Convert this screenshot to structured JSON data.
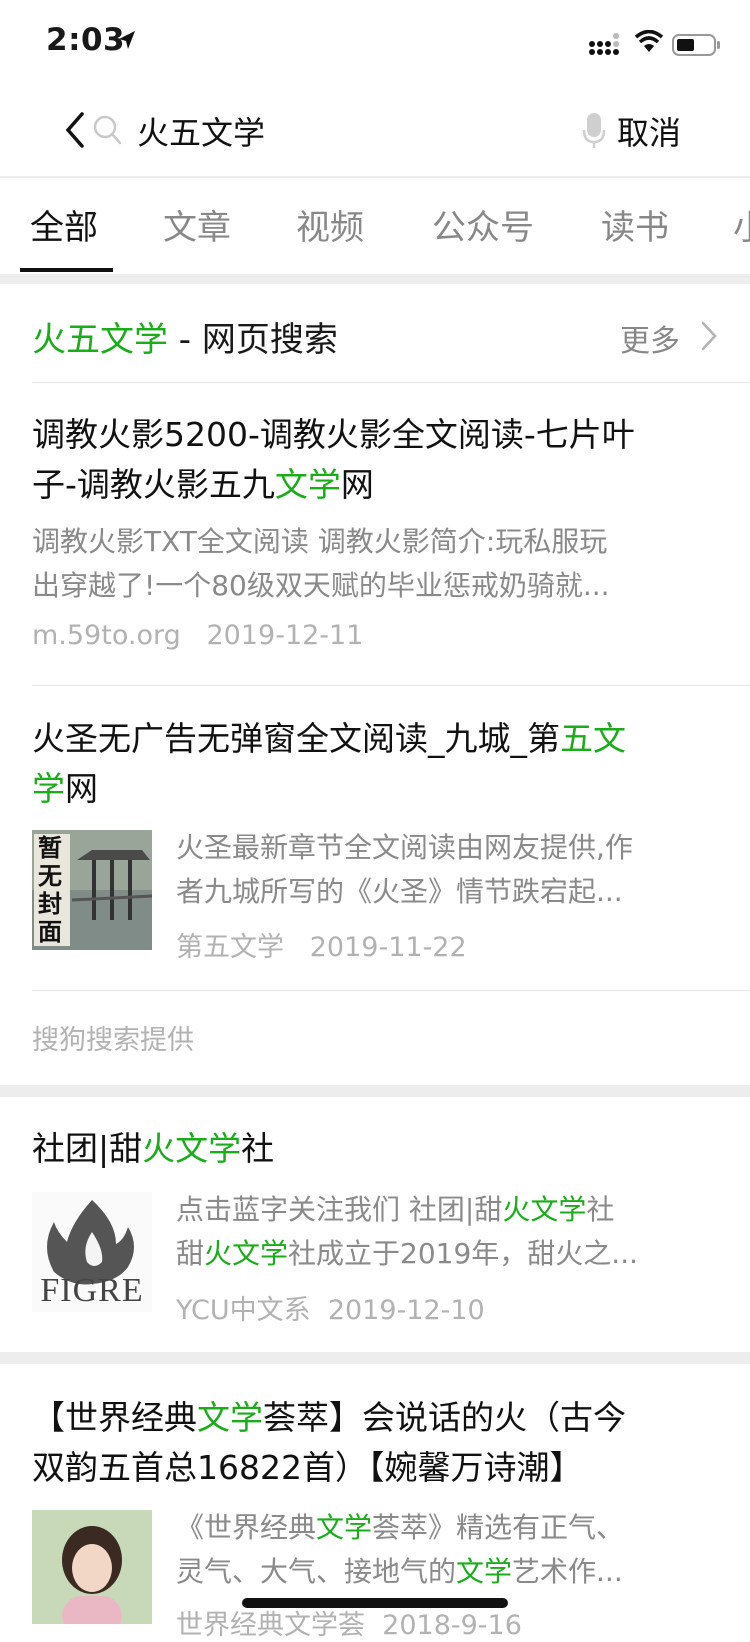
{
  "status": {
    "time": "2:03"
  },
  "search": {
    "query": "火五文学",
    "cancel": "取消"
  },
  "tabs": [
    "全部",
    "文章",
    "视频",
    "公众号",
    "读书",
    "小"
  ],
  "web_section": {
    "title_hl": "火五文学",
    "title_rest": " - 网页搜索",
    "more": "更多",
    "provider": "搜狗搜索提供"
  },
  "results": [
    {
      "title_line1": "调教火影5200-调教火影全文阅读-七片叶",
      "title_line2_pre": "子-调教火影五九",
      "title_line2_hl": "文学",
      "title_line2_post": "网",
      "desc_line1": "调教火影TXT全文阅读 调教火影简介:玩私服玩",
      "desc_line2": "出穿越了!一个80级双天赋的毕业惩戒奶骑就...",
      "source": "m.59to.org",
      "date": "2019-12-11"
    },
    {
      "title_line1_pre": "火圣无广告无弹窗全文阅读_九城_第",
      "title_line1_hl": "五文",
      "title_line2_hl": "学",
      "title_line2_post": "网",
      "desc_line1": "火圣最新章节全文阅读由网友提供,作",
      "desc_line2": "者九城所写的《火圣》情节跌宕起...",
      "source": "第五文学",
      "date": "2019-11-22",
      "thumb_text": "暂无封面"
    }
  ],
  "articles": [
    {
      "title_pre": "社团|甜",
      "title_hl": "火文学",
      "title_post": "社",
      "desc1_pre": "点击蓝字关注我们 社团|甜",
      "desc1_hl": "火文学",
      "desc1_post": "社",
      "desc2_pre": "甜",
      "desc2_hl": "火文学",
      "desc2_post": "社成立于2019年，甜火之...",
      "source": "YCU中文系",
      "date": "2019-12-10",
      "thumb_text": "FIGRE"
    },
    {
      "title1_pre": "【世界经典",
      "title1_hl": "文学",
      "title1_post": "荟萃】会说话的火（古今",
      "title2": "双韵五首总16822首）【婉馨万诗潮】",
      "desc1_pre": "《世界经典",
      "desc1_hl": "文学",
      "desc1_post": "荟萃》精选有正气、",
      "desc2_pre": "灵气、大气、接地气的",
      "desc2_hl": "文学",
      "desc2_post": "艺术作...",
      "source": "世界经典文学荟",
      "date": "2018-9-16"
    }
  ],
  "colors": {
    "accent_green": "#1aad19",
    "gray_text": "#8a8a8a",
    "light_gray": "#b2b2b2"
  }
}
